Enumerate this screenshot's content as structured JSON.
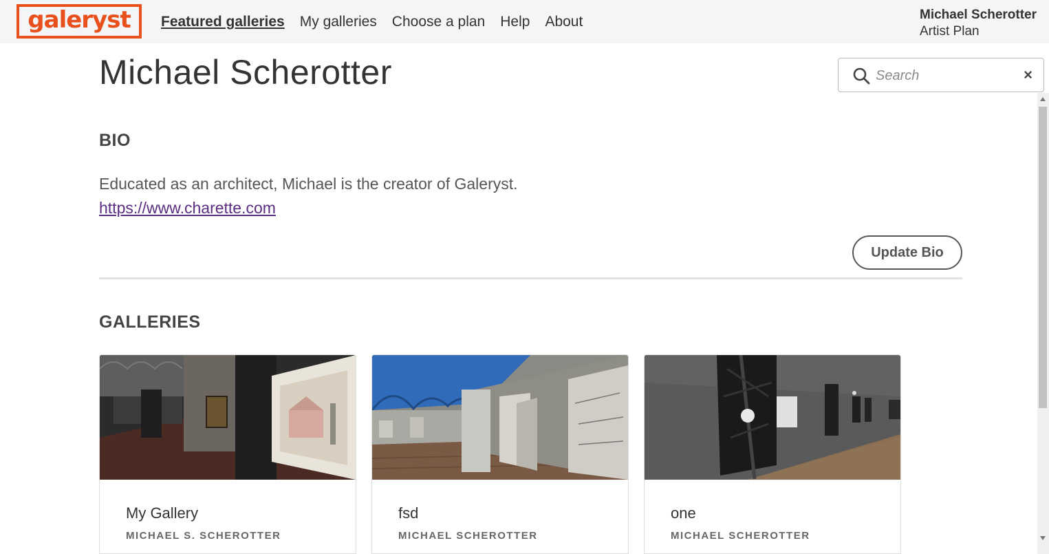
{
  "brand": {
    "logo_text": "galeryst",
    "color": "#e8501c"
  },
  "nav": {
    "items": [
      {
        "label": "Featured galleries",
        "active": true
      },
      {
        "label": "My galleries",
        "active": false
      },
      {
        "label": "Choose a plan",
        "active": false
      },
      {
        "label": "Help",
        "active": false
      },
      {
        "label": "About",
        "active": false
      }
    ]
  },
  "user": {
    "name": "Michael Scherotter",
    "plan": "Artist Plan"
  },
  "page": {
    "title": "Michael Scherotter"
  },
  "search": {
    "placeholder": "Search",
    "value": "",
    "icon": "search-icon",
    "clear_label": "×"
  },
  "bio": {
    "heading": "BIO",
    "text": "Educated as an architect, Michael is the creator of Galeryst.",
    "link": "https://www.charette.com",
    "update_label": "Update Bio"
  },
  "galleries": {
    "heading": "GALLERIES",
    "items": [
      {
        "title": "My Gallery",
        "author": "MICHAEL S. SCHEROTTER"
      },
      {
        "title": "fsd",
        "author": "MICHAEL SCHEROTTER"
      },
      {
        "title": "one",
        "author": "MICHAEL SCHEROTTER"
      }
    ]
  }
}
